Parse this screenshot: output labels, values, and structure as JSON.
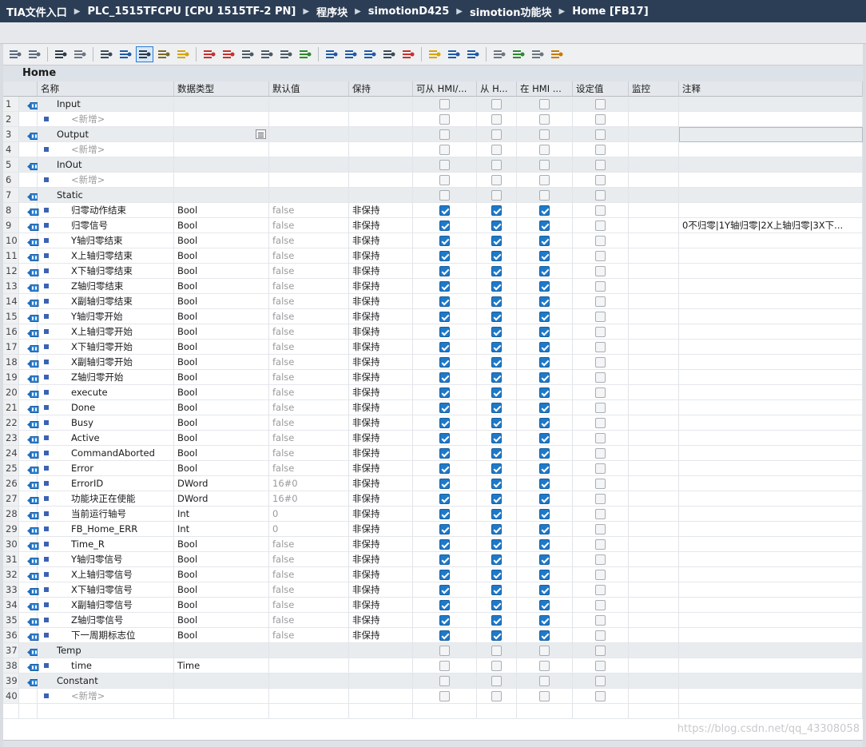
{
  "breadcrumb": [
    "TIA文件入口",
    "PLC_1515TFCPU [CPU 1515TF-2 PN]",
    "程序块",
    "simotionD425",
    "simotion功能块",
    "Home [FB17]"
  ],
  "block_name": "Home",
  "toolbar_icons": [
    "insert-row-icon",
    "add-row-icon",
    "expand-icon",
    "expand-all-icon",
    "network-icon",
    "detailed-view-icon",
    "block-interface-icon",
    "download-icon",
    "star-icon",
    "delete-icon",
    "delete-all-icon",
    "copy-icon",
    "paste-icon",
    "monitor-icon",
    "check-icon",
    "indent-left-icon",
    "indent-right-icon",
    "outdent-icon",
    "network-comment-icon",
    "goto-icon",
    "wizard-icon",
    "prev-icon",
    "next-icon",
    "tools-icon",
    "monitor-on-icon",
    "monitor-off-icon",
    "lock-icon"
  ],
  "columns": [
    "名称",
    "数据类型",
    "默认值",
    "保持",
    "可从 HMI/...",
    "从 H...",
    "在 HMI ...",
    "设定值",
    "监控",
    "注释"
  ],
  "rows": [
    {
      "n": "1",
      "kind": "section",
      "name": "Input",
      "type": "",
      "default": "",
      "retain": "",
      "cb": [
        0,
        0,
        0,
        0
      ],
      "comment": ""
    },
    {
      "n": "2",
      "kind": "add",
      "name": "<新增>",
      "type": "",
      "default": "",
      "retain": "",
      "cb": [
        0,
        0,
        0,
        0
      ],
      "comment": ""
    },
    {
      "n": "3",
      "kind": "section",
      "name": "Output",
      "type": "",
      "default": "",
      "retain": "",
      "cb": [
        0,
        0,
        0,
        0
      ],
      "comment": "",
      "selected": true
    },
    {
      "n": "4",
      "kind": "add",
      "name": "<新增>",
      "type": "",
      "default": "",
      "retain": "",
      "cb": [
        0,
        0,
        0,
        0
      ],
      "comment": ""
    },
    {
      "n": "5",
      "kind": "section",
      "name": "InOut",
      "type": "",
      "default": "",
      "retain": "",
      "cb": [
        0,
        0,
        0,
        0
      ],
      "comment": ""
    },
    {
      "n": "6",
      "kind": "add",
      "name": "<新增>",
      "type": "",
      "default": "",
      "retain": "",
      "cb": [
        0,
        0,
        0,
        0
      ],
      "comment": ""
    },
    {
      "n": "7",
      "kind": "section",
      "name": "Static",
      "type": "",
      "default": "",
      "retain": "",
      "cb": [
        0,
        0,
        0,
        0
      ],
      "comment": ""
    },
    {
      "n": "8",
      "kind": "var",
      "name": "归零动作结束",
      "type": "Bool",
      "default": "false",
      "retain": "非保持",
      "cb": [
        1,
        1,
        1,
        0
      ],
      "comment": ""
    },
    {
      "n": "9",
      "kind": "var",
      "name": "归零信号",
      "type": "Bool",
      "default": "false",
      "retain": "非保持",
      "cb": [
        1,
        1,
        1,
        0
      ],
      "comment": "0不归零|1Y轴归零|2X上轴归零|3X下..."
    },
    {
      "n": "10",
      "kind": "var",
      "name": "Y轴归零结束",
      "type": "Bool",
      "default": "false",
      "retain": "非保持",
      "cb": [
        1,
        1,
        1,
        0
      ],
      "comment": ""
    },
    {
      "n": "11",
      "kind": "var",
      "name": "X上轴归零结束",
      "type": "Bool",
      "default": "false",
      "retain": "非保持",
      "cb": [
        1,
        1,
        1,
        0
      ],
      "comment": ""
    },
    {
      "n": "12",
      "kind": "var",
      "name": "X下轴归零结束",
      "type": "Bool",
      "default": "false",
      "retain": "非保持",
      "cb": [
        1,
        1,
        1,
        0
      ],
      "comment": ""
    },
    {
      "n": "13",
      "kind": "var",
      "name": "Z轴归零结束",
      "type": "Bool",
      "default": "false",
      "retain": "非保持",
      "cb": [
        1,
        1,
        1,
        0
      ],
      "comment": ""
    },
    {
      "n": "14",
      "kind": "var",
      "name": "X副轴归零结束",
      "type": "Bool",
      "default": "false",
      "retain": "非保持",
      "cb": [
        1,
        1,
        1,
        0
      ],
      "comment": ""
    },
    {
      "n": "15",
      "kind": "var",
      "name": "Y轴归零开始",
      "type": "Bool",
      "default": "false",
      "retain": "非保持",
      "cb": [
        1,
        1,
        1,
        0
      ],
      "comment": ""
    },
    {
      "n": "16",
      "kind": "var",
      "name": "X上轴归零开始",
      "type": "Bool",
      "default": "false",
      "retain": "非保持",
      "cb": [
        1,
        1,
        1,
        0
      ],
      "comment": ""
    },
    {
      "n": "17",
      "kind": "var",
      "name": "X下轴归零开始",
      "type": "Bool",
      "default": "false",
      "retain": "非保持",
      "cb": [
        1,
        1,
        1,
        0
      ],
      "comment": ""
    },
    {
      "n": "18",
      "kind": "var",
      "name": "X副轴归零开始",
      "type": "Bool",
      "default": "false",
      "retain": "非保持",
      "cb": [
        1,
        1,
        1,
        0
      ],
      "comment": ""
    },
    {
      "n": "19",
      "kind": "var",
      "name": "Z轴归零开始",
      "type": "Bool",
      "default": "false",
      "retain": "非保持",
      "cb": [
        1,
        1,
        1,
        0
      ],
      "comment": ""
    },
    {
      "n": "20",
      "kind": "var",
      "name": "execute",
      "type": "Bool",
      "default": "false",
      "retain": "非保持",
      "cb": [
        1,
        1,
        1,
        0
      ],
      "comment": ""
    },
    {
      "n": "21",
      "kind": "var",
      "name": "Done",
      "type": "Bool",
      "default": "false",
      "retain": "非保持",
      "cb": [
        1,
        1,
        1,
        0
      ],
      "comment": ""
    },
    {
      "n": "22",
      "kind": "var",
      "name": "Busy",
      "type": "Bool",
      "default": "false",
      "retain": "非保持",
      "cb": [
        1,
        1,
        1,
        0
      ],
      "comment": ""
    },
    {
      "n": "23",
      "kind": "var",
      "name": "Active",
      "type": "Bool",
      "default": "false",
      "retain": "非保持",
      "cb": [
        1,
        1,
        1,
        0
      ],
      "comment": ""
    },
    {
      "n": "24",
      "kind": "var",
      "name": "CommandAborted",
      "type": "Bool",
      "default": "false",
      "retain": "非保持",
      "cb": [
        1,
        1,
        1,
        0
      ],
      "comment": ""
    },
    {
      "n": "25",
      "kind": "var",
      "name": "Error",
      "type": "Bool",
      "default": "false",
      "retain": "非保持",
      "cb": [
        1,
        1,
        1,
        0
      ],
      "comment": ""
    },
    {
      "n": "26",
      "kind": "var",
      "name": "ErrorID",
      "type": "DWord",
      "default": "16#0",
      "retain": "非保持",
      "cb": [
        1,
        1,
        1,
        0
      ],
      "comment": ""
    },
    {
      "n": "27",
      "kind": "var",
      "name": "功能块正在使能",
      "type": "DWord",
      "default": "16#0",
      "retain": "非保持",
      "cb": [
        1,
        1,
        1,
        0
      ],
      "comment": ""
    },
    {
      "n": "28",
      "kind": "var",
      "name": "当前运行轴号",
      "type": "Int",
      "default": "0",
      "retain": "非保持",
      "cb": [
        1,
        1,
        1,
        0
      ],
      "comment": ""
    },
    {
      "n": "29",
      "kind": "var",
      "name": "FB_Home_ERR",
      "type": "Int",
      "default": "0",
      "retain": "非保持",
      "cb": [
        1,
        1,
        1,
        0
      ],
      "comment": ""
    },
    {
      "n": "30",
      "kind": "var",
      "name": "Time_R",
      "type": "Bool",
      "default": "false",
      "retain": "非保持",
      "cb": [
        1,
        1,
        1,
        0
      ],
      "comment": ""
    },
    {
      "n": "31",
      "kind": "var",
      "name": "Y轴归零信号",
      "type": "Bool",
      "default": "false",
      "retain": "非保持",
      "cb": [
        1,
        1,
        1,
        0
      ],
      "comment": ""
    },
    {
      "n": "32",
      "kind": "var",
      "name": "X上轴归零信号",
      "type": "Bool",
      "default": "false",
      "retain": "非保持",
      "cb": [
        1,
        1,
        1,
        0
      ],
      "comment": ""
    },
    {
      "n": "33",
      "kind": "var",
      "name": "X下轴归零信号",
      "type": "Bool",
      "default": "false",
      "retain": "非保持",
      "cb": [
        1,
        1,
        1,
        0
      ],
      "comment": ""
    },
    {
      "n": "34",
      "kind": "var",
      "name": "X副轴归零信号",
      "type": "Bool",
      "default": "false",
      "retain": "非保持",
      "cb": [
        1,
        1,
        1,
        0
      ],
      "comment": ""
    },
    {
      "n": "35",
      "kind": "var",
      "name": "Z轴归零信号",
      "type": "Bool",
      "default": "false",
      "retain": "非保持",
      "cb": [
        1,
        1,
        1,
        0
      ],
      "comment": ""
    },
    {
      "n": "36",
      "kind": "var",
      "name": "下一周期标志位",
      "type": "Bool",
      "default": "false",
      "retain": "非保持",
      "cb": [
        1,
        1,
        1,
        0
      ],
      "comment": ""
    },
    {
      "n": "37",
      "kind": "section",
      "name": "Temp",
      "type": "",
      "default": "",
      "retain": "",
      "cb": [
        0,
        0,
        0,
        0
      ],
      "comment": ""
    },
    {
      "n": "38",
      "kind": "var",
      "name": "time",
      "type": "Time",
      "default": "",
      "retain": "",
      "cb": [
        0,
        0,
        0,
        0
      ],
      "comment": ""
    },
    {
      "n": "39",
      "kind": "section",
      "name": "Constant",
      "type": "",
      "default": "",
      "retain": "",
      "cb": [
        0,
        0,
        0,
        0
      ],
      "comment": ""
    },
    {
      "n": "40",
      "kind": "add",
      "name": "<新增>",
      "type": "",
      "default": "",
      "retain": "",
      "cb": [
        0,
        0,
        0,
        0
      ],
      "comment": ""
    }
  ],
  "watermark": "https://blog.csdn.net/qq_43308058"
}
